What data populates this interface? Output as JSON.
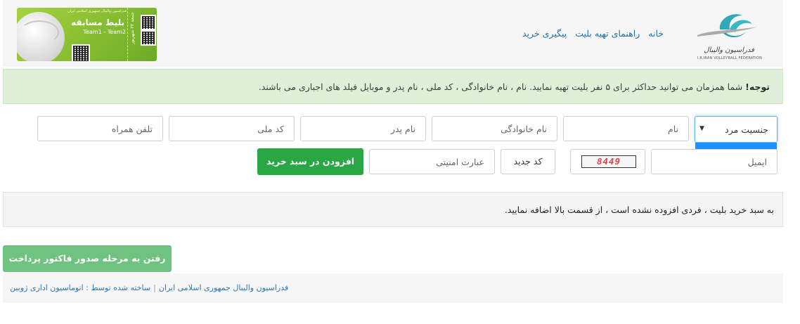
{
  "header": {
    "logo_caption": "I.R.IRAN VOLLEYBALL FEDERATION",
    "nav": [
      "خانه",
      "راهنمای تهیه بلیت",
      "پیگیری خرید"
    ],
    "ticket": {
      "small_text": "فدراسیون والیبال جمهوری اسلامی ایران",
      "title": "بلیط مسابقه",
      "teams": "Team1 - Team2",
      "date": "جمعه ۲۲ شهریور"
    }
  },
  "alert": {
    "bold": "توجه!",
    "text": " شما همزمان می توانید حداکثر برای ۵ نفر بلیت تهیه نمایید. نام ، نام خانوادگی ، کد ملی ، نام پدر و موبایل فیلد های اجباری می باشند."
  },
  "form": {
    "gender_selected": "جنسیت مرد",
    "gender_options": [
      "جنسیت مرد"
    ],
    "placeholders": {
      "first_name": "نام",
      "last_name": "نام خانوادگی",
      "father_name": "نام پدر",
      "national_code": "کد ملی",
      "mobile": "تلفن همراه",
      "email": "ایمیل",
      "captcha": "عبارت امنیتی"
    },
    "captcha_code": "8449",
    "new_code_label": "کد جدید",
    "add_to_cart_label": "افزودن در سبد خرید"
  },
  "cart": {
    "empty_message": "به سبد خرید بلیت ، فردی افزوده نشده است ، از قسمت بالا اضافه نمایید."
  },
  "payment_button_label": "رفتن به مرحله صدور فاکتور پرداخت",
  "footer": {
    "left": "فدراسیون والیبال جمهوری اسلامی ایران",
    "separator": "|",
    "right": "ساخته شده توسط : اتوماسیون اداری ژوبین"
  },
  "colors": {
    "link": "#1f6fae",
    "primary_green": "#2aa745",
    "light_green": "#6fc27f",
    "alert_bg": "#dff0d8",
    "dropdown_highlight": "#1e90ff"
  }
}
